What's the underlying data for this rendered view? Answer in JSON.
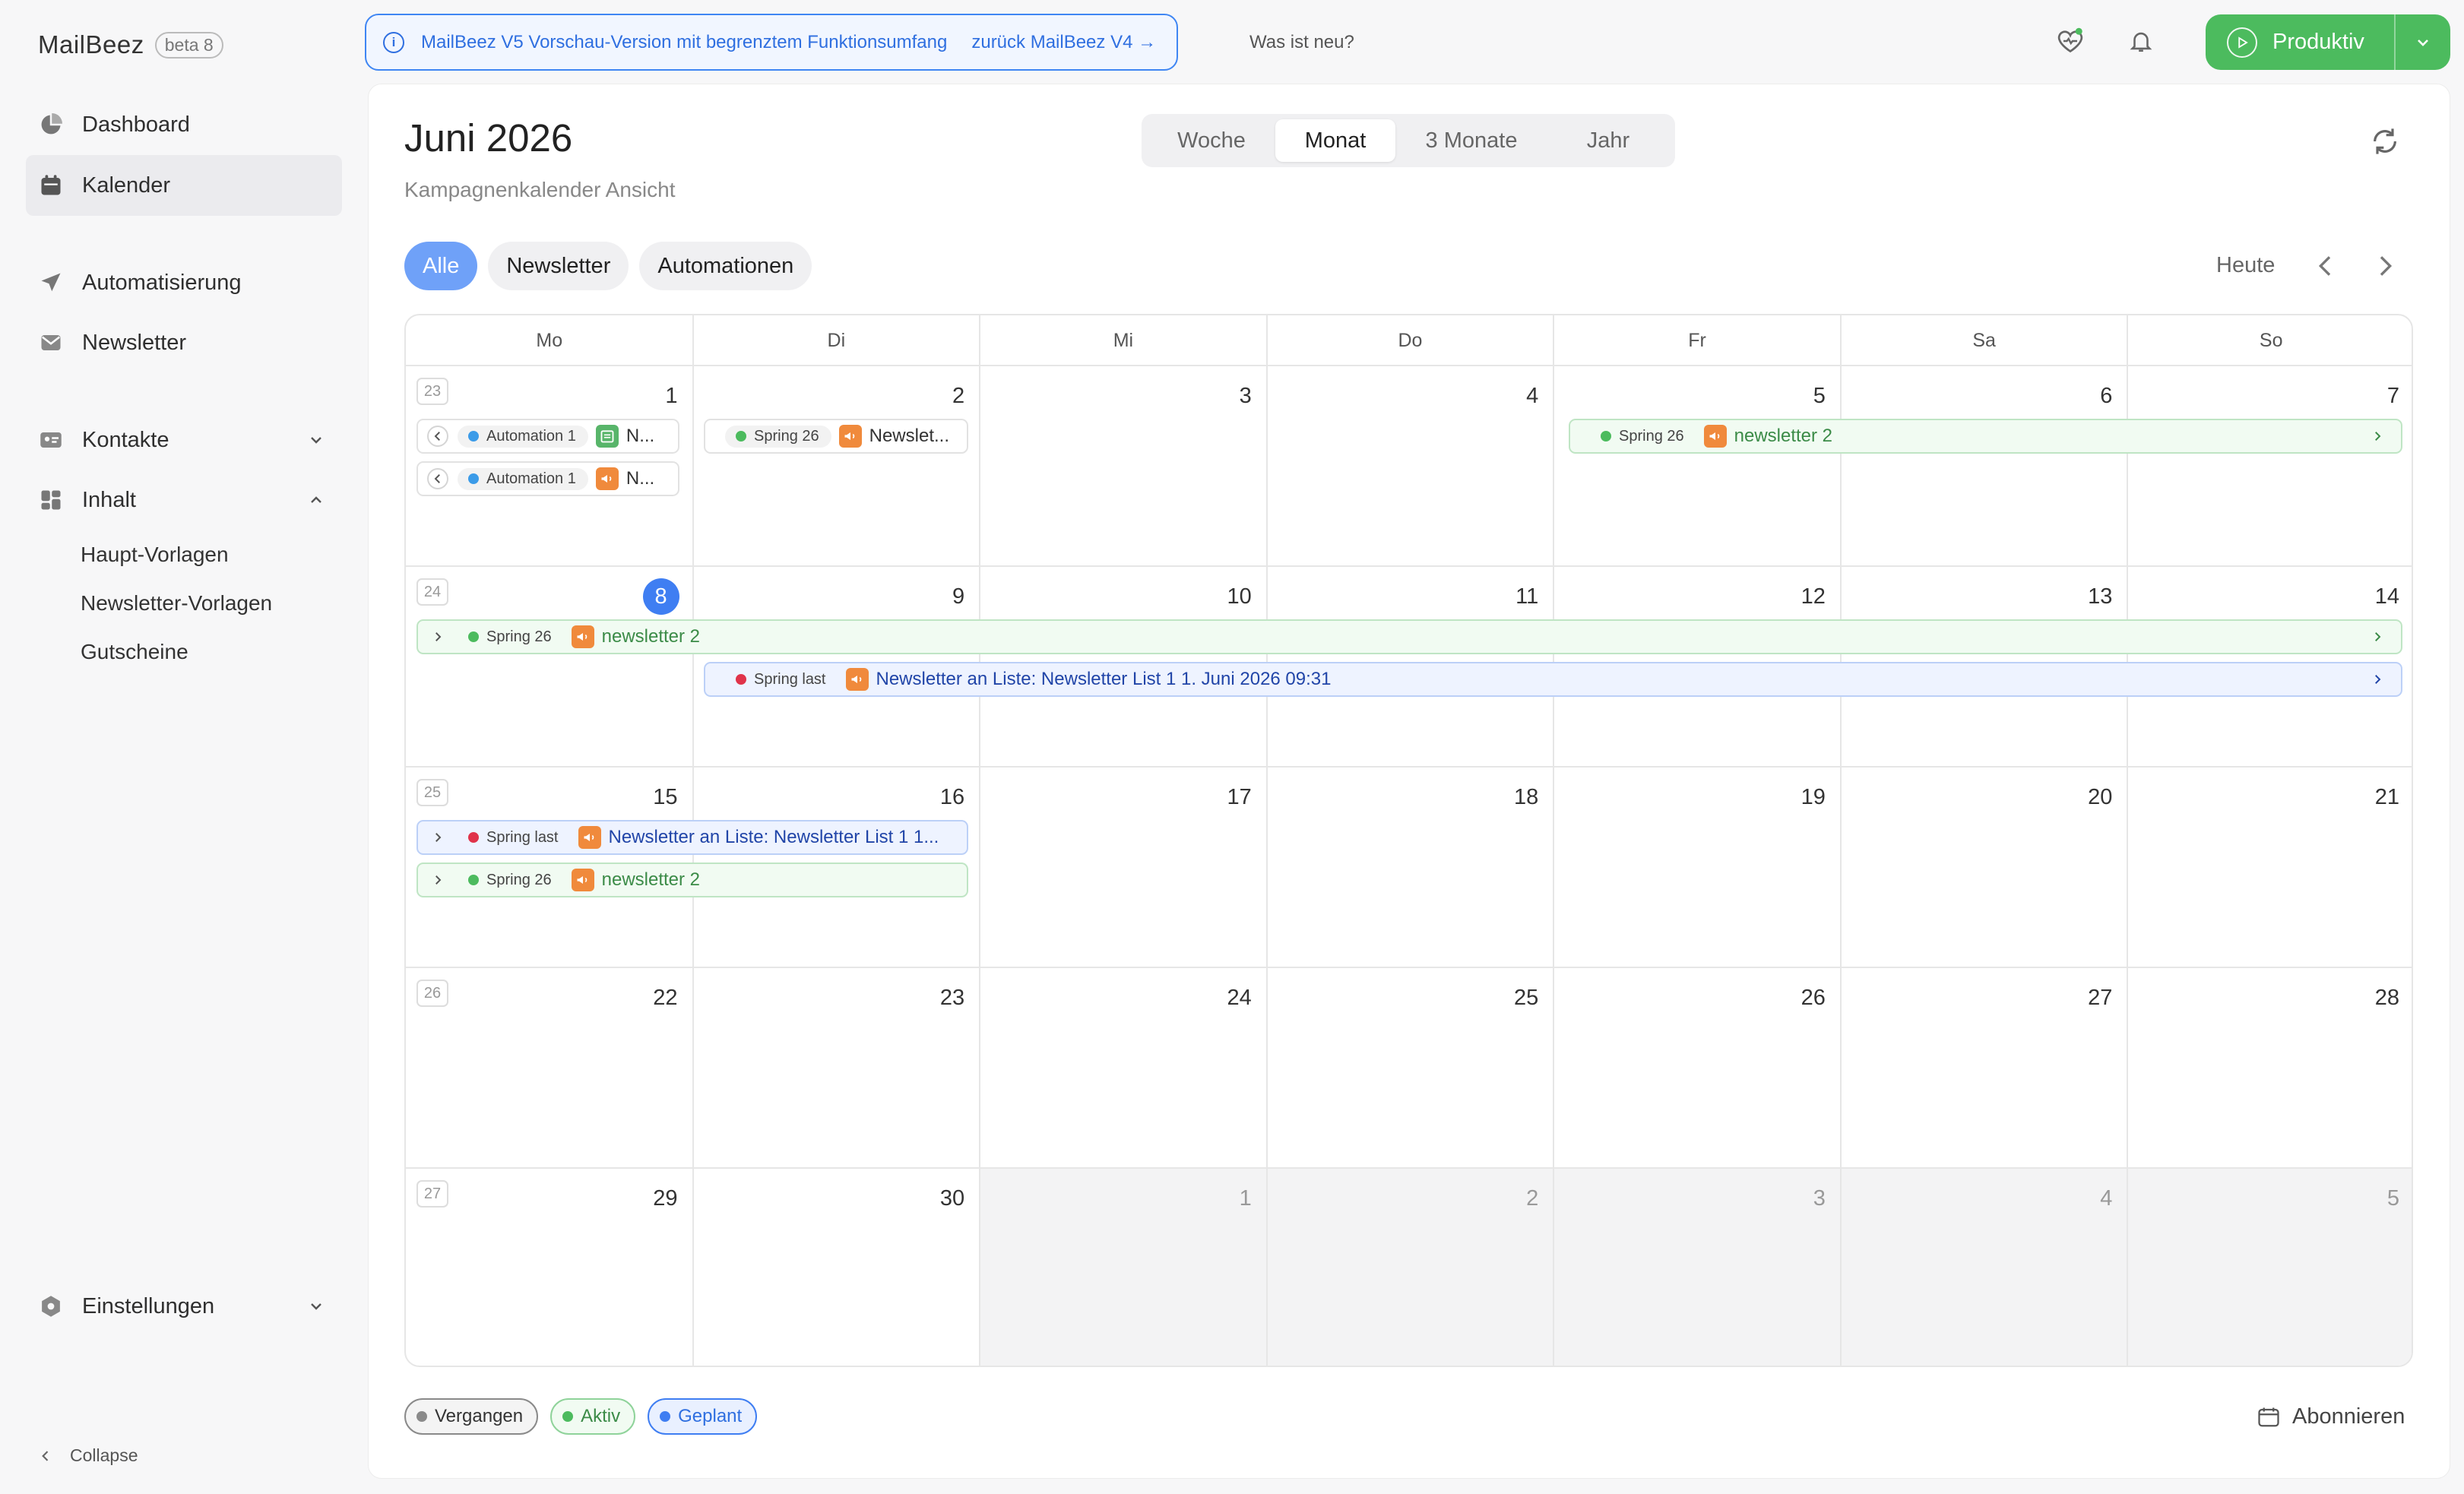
{
  "brand": {
    "name": "MailBeez",
    "badge": "beta 8"
  },
  "sidebar": {
    "items": [
      {
        "label": "Dashboard",
        "icon": "dashboard-icon"
      },
      {
        "label": "Kalender",
        "icon": "calendar-icon"
      },
      {
        "label": "Automatisierung",
        "icon": "send-icon"
      },
      {
        "label": "Newsletter",
        "icon": "mail-icon"
      },
      {
        "label": "Kontakte",
        "icon": "contacts-icon"
      },
      {
        "label": "Inhalt",
        "icon": "content-icon"
      },
      {
        "label": "Einstellungen",
        "icon": "settings-icon"
      }
    ],
    "sub_items": [
      "Haupt-Vorlagen",
      "Newsletter-Vorlagen",
      "Gutscheine"
    ],
    "collapse": "Collapse"
  },
  "topbar": {
    "banner_text": "MailBeez V5 Vorschau-Version mit begrenztem Funktionsumfang",
    "banner_link": "zurück MailBeez V4 →",
    "whatsnew": "Was ist neu?",
    "mode_button": "Produktiv",
    "mode_color": "#4cbb5e"
  },
  "calendar": {
    "title": "Juni 2026",
    "subtitle": "Kampagnenkalender Ansicht",
    "view_tabs": [
      "Woche",
      "Monat",
      "3 Monate",
      "Jahr"
    ],
    "active_view": "Monat",
    "filters": [
      "Alle",
      "Newsletter",
      "Automationen"
    ],
    "active_filter": "Alle",
    "today_label": "Heute",
    "weekdays": [
      "Mo",
      "Di",
      "Mi",
      "Do",
      "Fr",
      "Sa",
      "So"
    ],
    "weeks": [
      {
        "num": "23",
        "days": [
          "1",
          "2",
          "3",
          "4",
          "5",
          "6",
          "7"
        ]
      },
      {
        "num": "24",
        "days": [
          "8",
          "9",
          "10",
          "11",
          "12",
          "13",
          "14"
        ]
      },
      {
        "num": "25",
        "days": [
          "15",
          "16",
          "17",
          "18",
          "19",
          "20",
          "21"
        ]
      },
      {
        "num": "26",
        "days": [
          "22",
          "23",
          "24",
          "25",
          "26",
          "27",
          "28"
        ]
      },
      {
        "num": "27",
        "days": [
          "29",
          "30",
          "1",
          "2",
          "3",
          "4",
          "5"
        ]
      }
    ],
    "today_day": "8",
    "events": [
      {
        "tag": "Automation 1",
        "label": "N...",
        "dot": "#3b9be8",
        "icon": "calendar-list-icon"
      },
      {
        "tag": "Automation 1",
        "label": "N...",
        "dot": "#3b9be8",
        "icon": "megaphone-icon"
      },
      {
        "tag": "Spring 26",
        "label": "Newslet...",
        "dot": "#4cbb5e",
        "icon": "megaphone-icon"
      },
      {
        "tag": "Spring 26",
        "label": "newsletter 2",
        "dot": "#4cbb5e",
        "icon": "megaphone-icon"
      },
      {
        "tag": "Spring 26",
        "label": "newsletter 2",
        "dot": "#4cbb5e",
        "icon": "megaphone-icon"
      },
      {
        "tag": "Spring last",
        "label": "Newsletter an Liste: Newsletter List 1 1. Juni 2026 09:31",
        "dot": "#e0334a",
        "icon": "megaphone-icon"
      },
      {
        "tag": "Spring last",
        "label": "Newsletter an Liste: Newsletter List 1 1...",
        "dot": "#e0334a",
        "icon": "megaphone-icon"
      },
      {
        "tag": "Spring 26",
        "label": "newsletter 2",
        "dot": "#4cbb5e",
        "icon": "megaphone-icon"
      }
    ]
  },
  "legend": [
    {
      "label": "Vergangen",
      "color": "#8a8a8a"
    },
    {
      "label": "Aktiv",
      "color": "#4cbb5e"
    },
    {
      "label": "Geplant",
      "color": "#3f7ef2"
    }
  ],
  "subscribe": "Abonnieren"
}
